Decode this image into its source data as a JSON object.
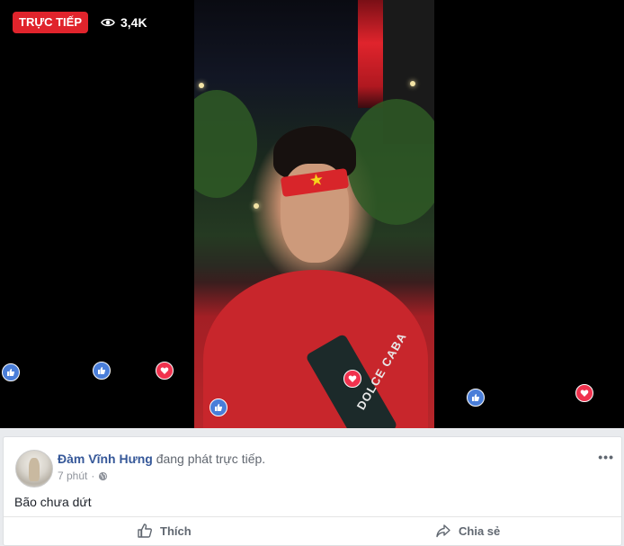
{
  "video": {
    "live_label": "TRỰC TIẾP",
    "viewer_count": "3,4K",
    "strap_text": "DOLCE CABA"
  },
  "post": {
    "author": "Đàm Vĩnh Hưng",
    "action_text": "đang phát trực tiếp.",
    "time": "7 phút",
    "separator": "·",
    "body": "Bão chưa dứt",
    "more": "•••"
  },
  "actions": {
    "like_label": "Thích",
    "share_label": "Chia sẻ"
  },
  "colors": {
    "live_red": "#e0242c",
    "link_blue": "#365899",
    "like_blue": "#4a7ed9",
    "love_red": "#f0324e"
  }
}
